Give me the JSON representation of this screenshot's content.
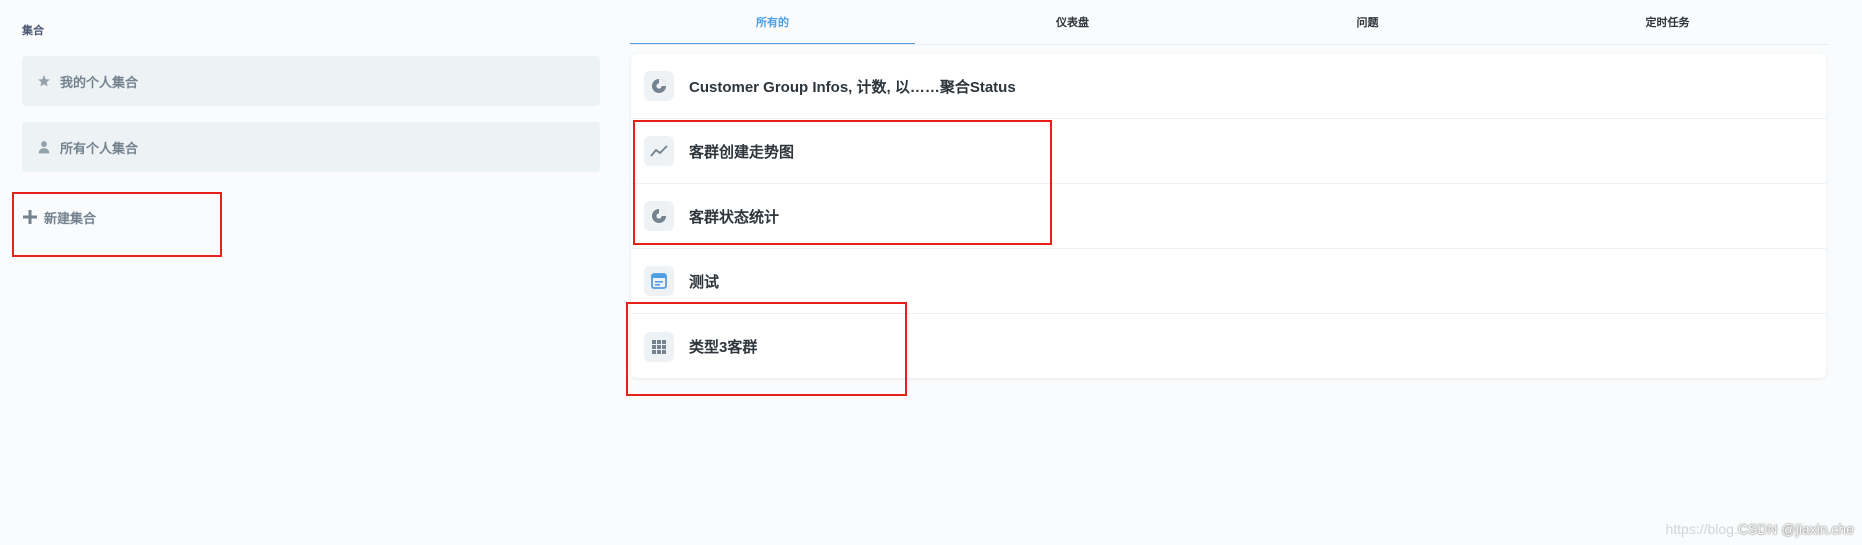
{
  "sidebar": {
    "title": "集合",
    "items": [
      {
        "label": "我的个人集合",
        "icon": "star-icon"
      },
      {
        "label": "所有个人集合",
        "icon": "person-icon"
      }
    ],
    "new_collection": {
      "label": "新建集合",
      "icon": "plus-icon"
    }
  },
  "tabs": [
    {
      "label": "所有的",
      "active": true
    },
    {
      "label": "仪表盘",
      "active": false
    },
    {
      "label": "问题",
      "active": false
    },
    {
      "label": "定时任务",
      "active": false
    }
  ],
  "items": [
    {
      "label": "Customer Group Infos, 计数, 以……聚合Status",
      "icon": "pie-chart-icon"
    },
    {
      "label": "客群创建走势图",
      "icon": "line-chart-icon"
    },
    {
      "label": "客群状态统计",
      "icon": "pie-chart-icon"
    },
    {
      "label": "测试",
      "icon": "dashboard-icon"
    },
    {
      "label": "类型3客群",
      "icon": "table-grid-icon"
    }
  ],
  "watermark": {
    "faded": "https://blog.",
    "main": "CSDN @jiaxin.che"
  },
  "colors": {
    "accent": "#509ee3",
    "annotation": "#e8201a",
    "muted": "#74838f"
  }
}
